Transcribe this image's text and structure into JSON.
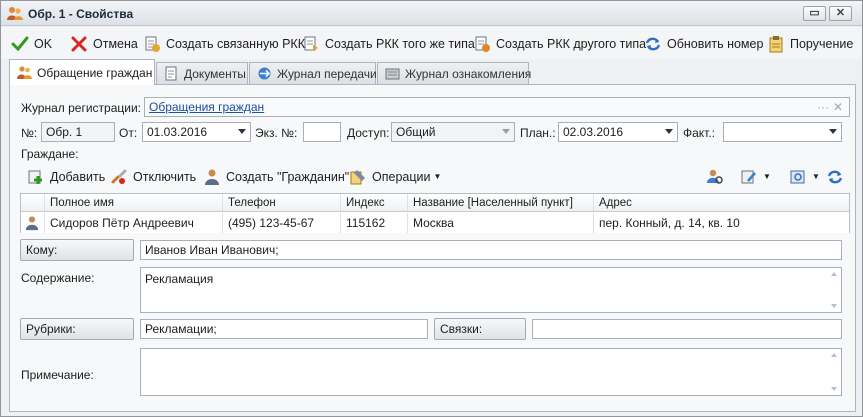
{
  "window": {
    "title": "Обр. 1 - Свойства",
    "minimize_glyph": "▭",
    "close_glyph": "✕"
  },
  "toolbar": {
    "ok": "OK",
    "cancel": "Отмена",
    "create_linked": "Создать связанную РКК",
    "create_same": "Создать РКК того же типа",
    "create_other": "Создать РКК другого типа",
    "update_number": "Обновить номер",
    "assignment": "Поручение"
  },
  "tabs": [
    {
      "label": "Обращение граждан",
      "icon": "citizens-icon"
    },
    {
      "label": "Документы",
      "icon": "document-icon"
    },
    {
      "label": "Журнал передачи",
      "icon": "transfer-log-icon"
    },
    {
      "label": "Журнал ознакомления",
      "icon": "review-log-icon"
    }
  ],
  "form": {
    "journal_label": "Журнал регистрации:",
    "journal_value": "Обращения граждан",
    "journal_more": "···",
    "number_label": "№:",
    "number_value": "Обр. 1",
    "from_label": "От:",
    "from_value": "01.03.2016",
    "copy_label": "Экз. №:",
    "copy_value": "",
    "access_label": "Доступ:",
    "access_value": "Общий",
    "plan_label": "План.:",
    "plan_value": "02.03.2016",
    "fact_label": "Факт.:",
    "fact_value": "",
    "citizens_label": "Граждане:"
  },
  "citizens_toolbar": {
    "add": "Добавить",
    "detach": "Отключить",
    "create_citizen": "Создать \"Гражданин\"",
    "operations": "Операции"
  },
  "grid": {
    "columns": [
      "Полное имя",
      "Телефон",
      "Индекс",
      "Название [Населенный пункт]",
      "Адрес"
    ],
    "rows": [
      {
        "name": "Сидоров Пётр Андреевич",
        "phone": "(495) 123-45-67",
        "index": "115162",
        "city": "Москва",
        "address": "пер. Конный, д. 14, кв. 10"
      }
    ]
  },
  "details": {
    "to_button": "Кому:",
    "to_value": "Иванов Иван Иванович;",
    "content_label": "Содержание:",
    "content_value": "Рекламация",
    "rubrics_button": "Рубрики:",
    "rubrics_value": "Рекламации;",
    "links_button": "Связки:",
    "links_value": "",
    "note_label": "Примечание:",
    "note_value": ""
  }
}
